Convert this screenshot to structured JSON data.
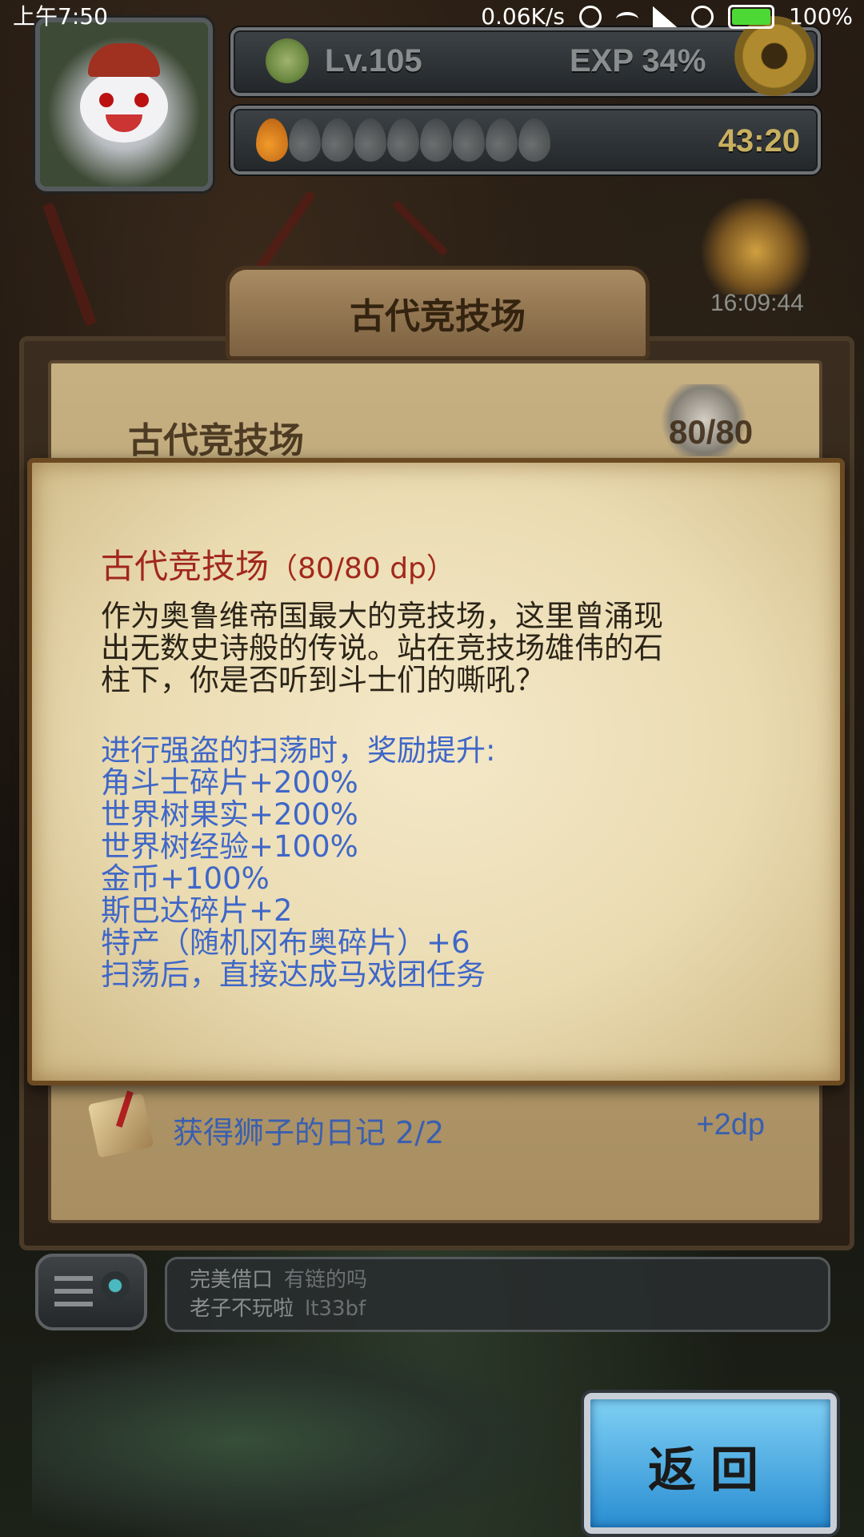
{
  "status_bar": {
    "time": "上午7:50",
    "speed": "0.06K/s",
    "battery": "100%"
  },
  "hud": {
    "level": "Lv.105",
    "exp": "EXP 34%",
    "energy_timer": "43:20",
    "carrots_full": 1,
    "carrots_total": 9,
    "event_clock": "16:09:44"
  },
  "background_panel": {
    "banner": "古代竞技场",
    "title": "古代竞技场",
    "count": "80/80"
  },
  "dialog": {
    "title": "古代竞技场",
    "title_sub": "（80/80 dp）",
    "description": [
      "作为奥鲁维帝国最大的竞技场，这里曾涌现",
      "出无数史诗般的传说。站在竞技场雄伟的石",
      "柱下，你是否听到斗士们的嘶吼？"
    ],
    "rewards": [
      "进行强盗的扫荡时，奖励提升:",
      "角斗士碎片+200%",
      "世界树果实+200%",
      "世界树经验+100%",
      "金币+100%",
      "斯巴达碎片+2",
      "特产（随机冈布奥碎片）+6",
      "扫荡后，直接达成马戏团任务"
    ]
  },
  "task": {
    "text": "获得狮子的日记 2/2",
    "reward": "+2dp"
  },
  "chat": {
    "lines": [
      {
        "name": "完美借口",
        "message": "有链的吗"
      },
      {
        "name": "老子不玩啦",
        "message": "lt33bf"
      }
    ]
  },
  "back_button": {
    "label": "返回"
  },
  "colors": {
    "title_red": "#a1281c",
    "reward_blue": "#3f67c8",
    "battery_green": "#4cd935"
  }
}
